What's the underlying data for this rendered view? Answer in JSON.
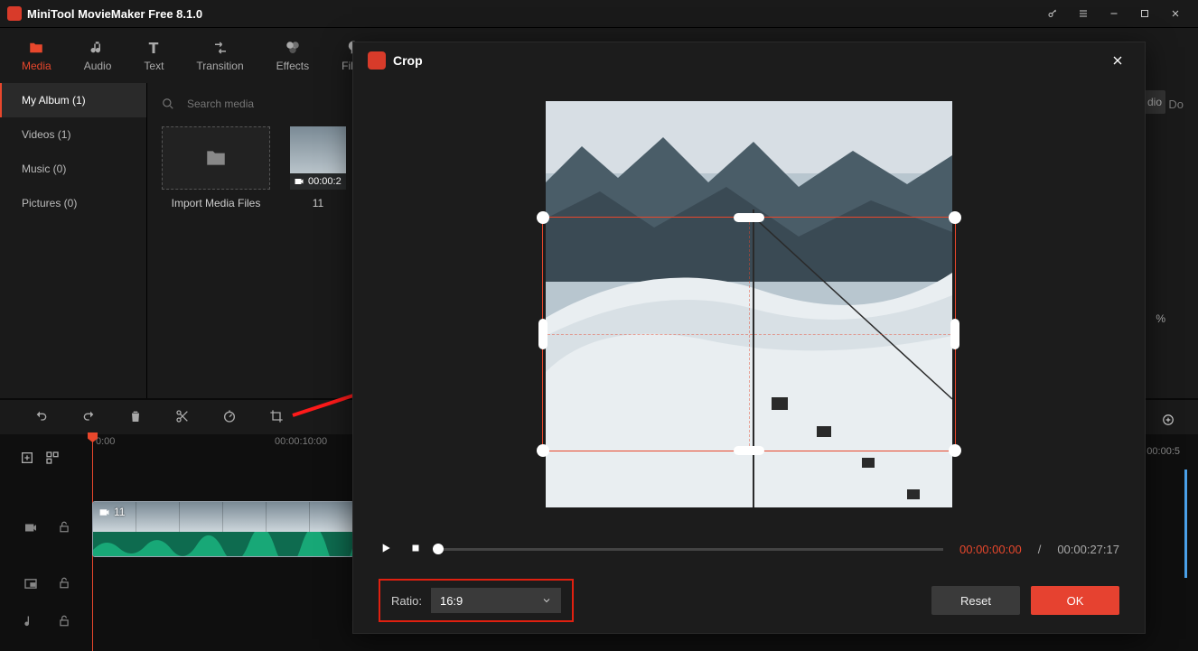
{
  "app": {
    "title": "MiniTool MovieMaker Free 8.1.0"
  },
  "tabs": {
    "media": "Media",
    "audio": "Audio",
    "text": "Text",
    "transition": "Transition",
    "effects": "Effects",
    "filter": "Filter"
  },
  "sidebar": {
    "myalbum": "My Album (1)",
    "videos": "Videos (1)",
    "music": "Music (0)",
    "pictures": "Pictures (0)"
  },
  "mediaPane": {
    "searchPlaceholder": "Search media",
    "downloadLabel": "Do",
    "importLabel": "Import Media Files",
    "clipDuration": "00:00:2",
    "clipFileName": "11"
  },
  "timeline": {
    "t0": "0:00",
    "t1": "00:00:10:00",
    "t2": "00:00:5",
    "clipBadge": "11"
  },
  "rightPeek": {
    "audioTab": "dio",
    "percent": "%"
  },
  "crop": {
    "title": "Crop",
    "timeCurrent": "00:00:00:00",
    "timeSep": " / ",
    "timeDuration": "00:00:27:17",
    "ratioLabel": "Ratio:",
    "ratioValue": "16:9",
    "reset": "Reset",
    "ok": "OK"
  }
}
